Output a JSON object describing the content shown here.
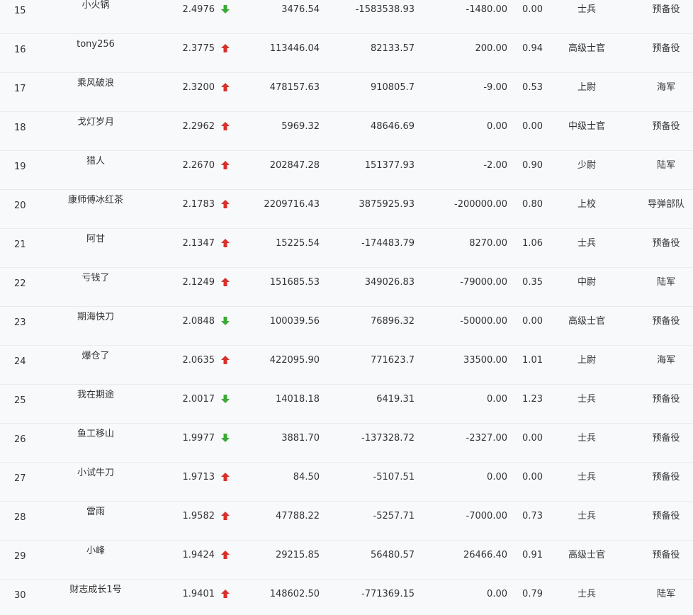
{
  "colors": {
    "up": "#d9302b",
    "down": "#3aaa35"
  },
  "rows": [
    {
      "rank": "15",
      "name": "小火锅",
      "score": "2.4976",
      "trend": "down",
      "v1": "3476.54",
      "v2": "-1583538.93",
      "v3": "-1480.00",
      "v4": "0.00",
      "military_rank": "士兵",
      "branch": "预备役"
    },
    {
      "rank": "16",
      "name": "tony256",
      "score": "2.3775",
      "trend": "up",
      "v1": "113446.04",
      "v2": "82133.57",
      "v3": "200.00",
      "v4": "0.94",
      "military_rank": "高级士官",
      "branch": "预备役"
    },
    {
      "rank": "17",
      "name": "乘风破浪",
      "score": "2.3200",
      "trend": "up",
      "v1": "478157.63",
      "v2": "910805.7",
      "v3": "-9.00",
      "v4": "0.53",
      "military_rank": "上尉",
      "branch": "海军"
    },
    {
      "rank": "18",
      "name": "戈灯岁月",
      "score": "2.2962",
      "trend": "up",
      "v1": "5969.32",
      "v2": "48646.69",
      "v3": "0.00",
      "v4": "0.00",
      "military_rank": "中级士官",
      "branch": "预备役"
    },
    {
      "rank": "19",
      "name": "猎人",
      "score": "2.2670",
      "trend": "up",
      "v1": "202847.28",
      "v2": "151377.93",
      "v3": "-2.00",
      "v4": "0.90",
      "military_rank": "少尉",
      "branch": "陆军"
    },
    {
      "rank": "20",
      "name": "康师傅冰红茶",
      "score": "2.1783",
      "trend": "up",
      "v1": "2209716.43",
      "v2": "3875925.93",
      "v3": "-200000.00",
      "v4": "0.80",
      "military_rank": "上校",
      "branch": "导弹部队"
    },
    {
      "rank": "21",
      "name": "阿甘",
      "score": "2.1347",
      "trend": "up",
      "v1": "15225.54",
      "v2": "-174483.79",
      "v3": "8270.00",
      "v4": "1.06",
      "military_rank": "士兵",
      "branch": "预备役"
    },
    {
      "rank": "22",
      "name": "亏钱了",
      "score": "2.1249",
      "trend": "up",
      "v1": "151685.53",
      "v2": "349026.83",
      "v3": "-79000.00",
      "v4": "0.35",
      "military_rank": "中尉",
      "branch": "陆军"
    },
    {
      "rank": "23",
      "name": "期海快刀",
      "score": "2.0848",
      "trend": "down",
      "v1": "100039.56",
      "v2": "76896.32",
      "v3": "-50000.00",
      "v4": "0.00",
      "military_rank": "高级士官",
      "branch": "预备役"
    },
    {
      "rank": "24",
      "name": "爆仓了",
      "score": "2.0635",
      "trend": "up",
      "v1": "422095.90",
      "v2": "771623.7",
      "v3": "33500.00",
      "v4": "1.01",
      "military_rank": "上尉",
      "branch": "海军"
    },
    {
      "rank": "25",
      "name": "我在期途",
      "score": "2.0017",
      "trend": "down",
      "v1": "14018.18",
      "v2": "6419.31",
      "v3": "0.00",
      "v4": "1.23",
      "military_rank": "士兵",
      "branch": "预备役"
    },
    {
      "rank": "26",
      "name": "鱼工移山",
      "score": "1.9977",
      "trend": "down",
      "v1": "3881.70",
      "v2": "-137328.72",
      "v3": "-2327.00",
      "v4": "0.00",
      "military_rank": "士兵",
      "branch": "预备役"
    },
    {
      "rank": "27",
      "name": "小试牛刀",
      "score": "1.9713",
      "trend": "up",
      "v1": "84.50",
      "v2": "-5107.51",
      "v3": "0.00",
      "v4": "0.00",
      "military_rank": "士兵",
      "branch": "预备役"
    },
    {
      "rank": "28",
      "name": "雷雨",
      "score": "1.9582",
      "trend": "up",
      "v1": "47788.22",
      "v2": "-5257.71",
      "v3": "-7000.00",
      "v4": "0.73",
      "military_rank": "士兵",
      "branch": "预备役"
    },
    {
      "rank": "29",
      "name": "小峰",
      "score": "1.9424",
      "trend": "up",
      "v1": "29215.85",
      "v2": "56480.57",
      "v3": "26466.40",
      "v4": "0.91",
      "military_rank": "高级士官",
      "branch": "预备役"
    },
    {
      "rank": "30",
      "name": "财志成长1号",
      "score": "1.9401",
      "trend": "up",
      "v1": "148602.50",
      "v2": "-771369.15",
      "v3": "0.00",
      "v4": "0.79",
      "military_rank": "士兵",
      "branch": "陆军"
    }
  ]
}
